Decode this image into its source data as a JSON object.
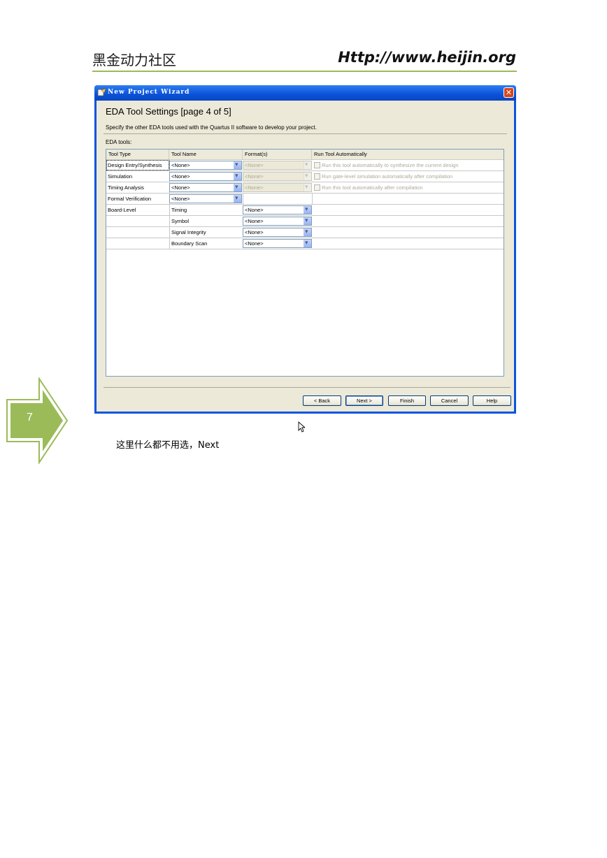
{
  "header": {
    "left_title": "黑金动力社区",
    "right_url": "Http://www.heijin.org"
  },
  "window": {
    "title": "New Project Wizard",
    "close_glyph": "✕",
    "page_title": "EDA Tool Settings [page 4 of 5]",
    "description": "Specify the other EDA tools used with the Quartus II software to develop your project.",
    "eda_tools_label": "EDA tools:",
    "columns": [
      "Tool Type",
      "Tool Name",
      "Format(s)",
      "Run Tool Automatically"
    ],
    "rows": [
      {
        "type": "Design Entry/Synthesis",
        "tool": "<None>",
        "format": "<None>",
        "run": "Run this tool automatically to synthesize the current design"
      },
      {
        "type": "Simulation",
        "tool": "<None>",
        "format": "<None>",
        "run": "Run gate-level simulation automatically after compilation"
      },
      {
        "type": "Timing Analysis",
        "tool": "<None>",
        "format": "<None>",
        "run": "Run this tool automatically after compilation"
      },
      {
        "type": "Formal Verification",
        "tool": "<None>"
      },
      {
        "type": "Board-Level",
        "tool": "Timing",
        "format": "<None>"
      },
      {
        "type": "",
        "tool": "Symbol",
        "format": "<None>"
      },
      {
        "type": "",
        "tool": "Signal Integrity",
        "format": "<None>"
      },
      {
        "type": "",
        "tool": "Boundary Scan",
        "format": "<None>"
      }
    ],
    "buttons": {
      "back": "< Back",
      "next": "Next >",
      "finish": "Finish",
      "cancel": "Cancel",
      "help": "Help"
    }
  },
  "step": {
    "number": "7",
    "color": "#9bbb59"
  },
  "caption": "这里什么都不用选，Next",
  "colors": {
    "accent_rule": "#9bbb59",
    "xp_blue": "#0a54e0",
    "dialog_bg": "#ece9d8"
  }
}
